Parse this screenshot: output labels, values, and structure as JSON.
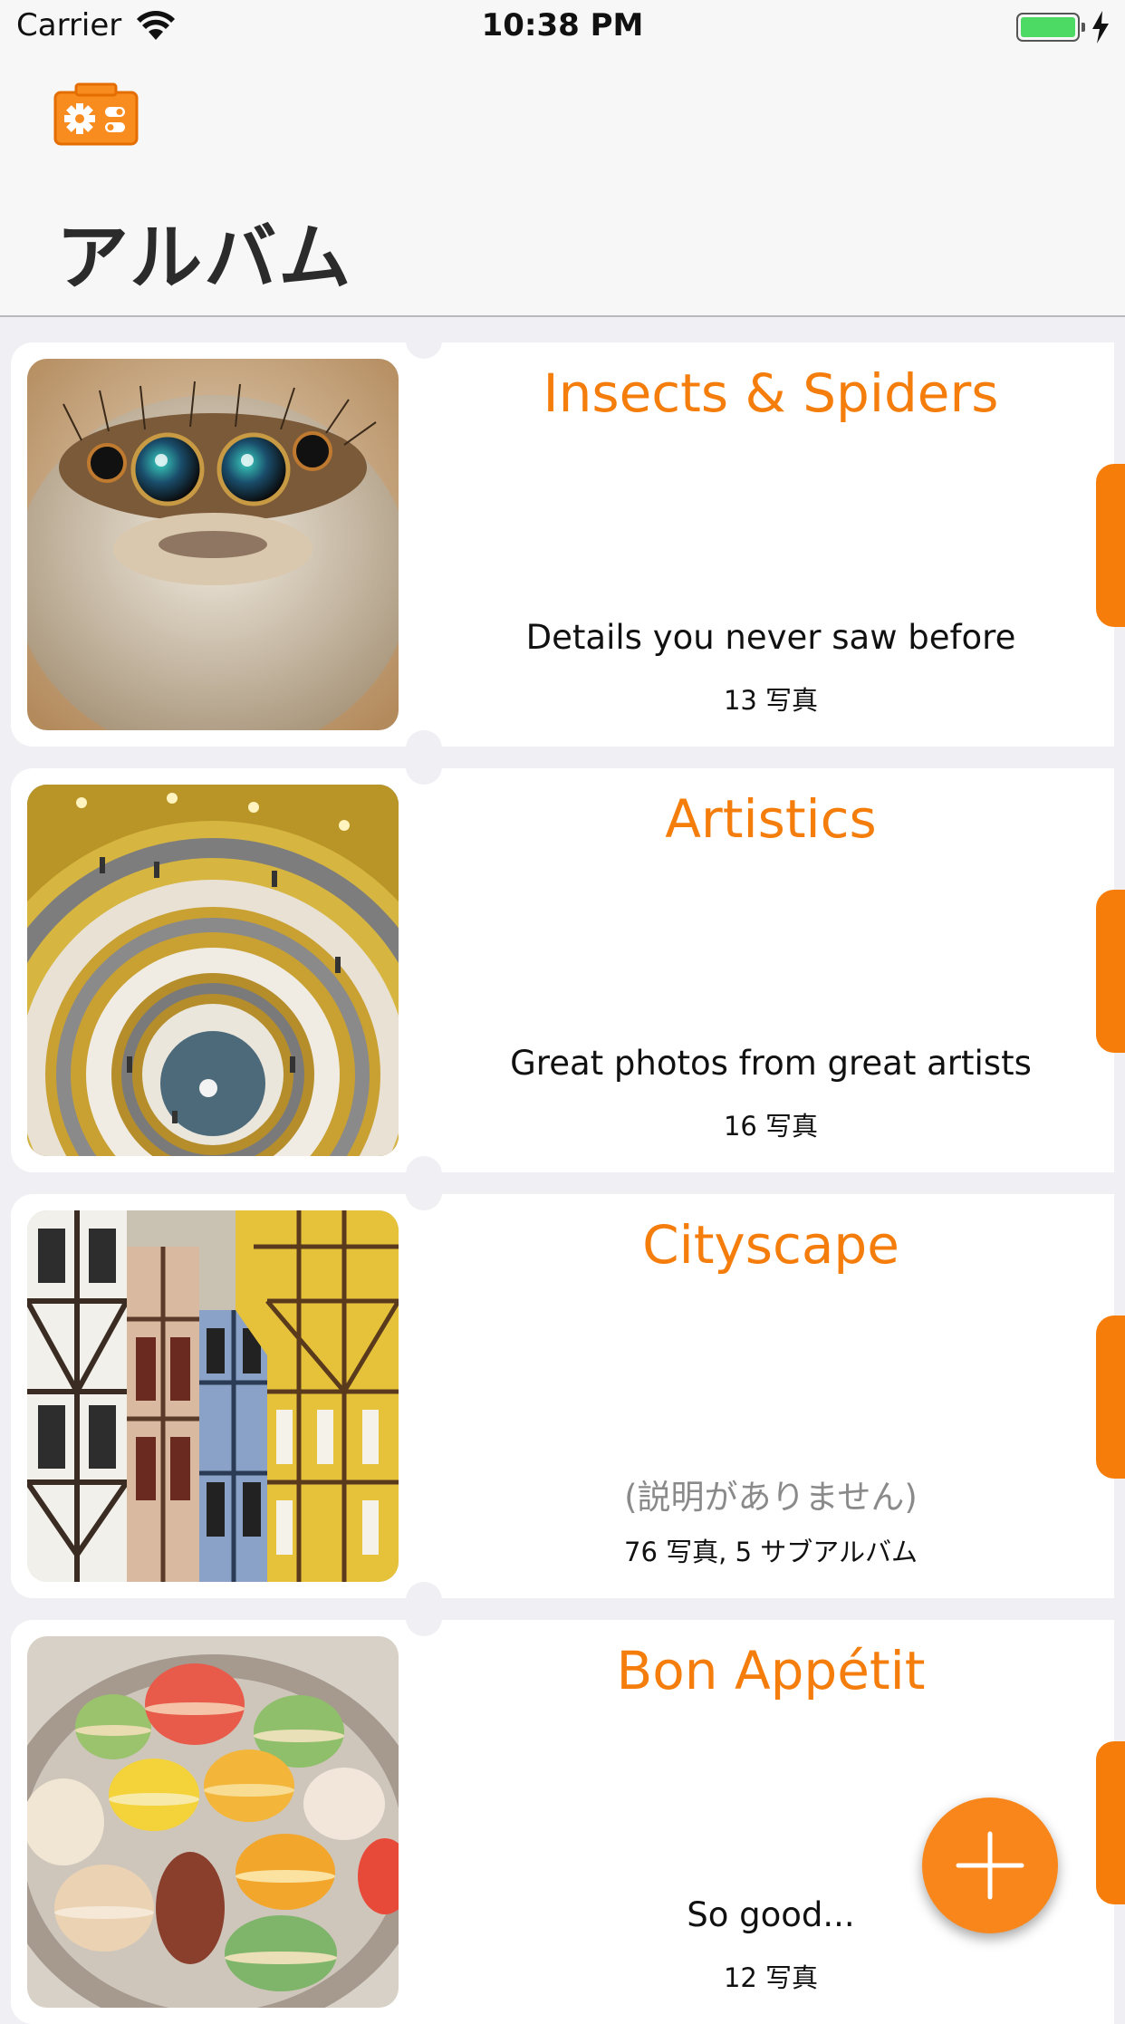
{
  "status_bar": {
    "carrier": "Carrier",
    "time": "10:38 PM"
  },
  "nav": {
    "title": "アルバム",
    "settings_icon": "camera-settings-icon"
  },
  "colors": {
    "accent": "#f47d0c",
    "background": "#efeff4"
  },
  "albums": [
    {
      "name": "Insects & Spiders",
      "description": "Details you never saw before",
      "count": "13 写真",
      "image": "jumping-spider"
    },
    {
      "name": "Artistics",
      "description": "Great photos from great artists",
      "count": "16 写真",
      "image": "spiral-staircase"
    },
    {
      "name": "Cityscape",
      "description": "(説明がありません)",
      "count": "76 写真, 5 サブアルバム",
      "image": "timber-houses"
    },
    {
      "name": "Bon Appétit",
      "description": "So good...",
      "count": "12 写真",
      "image": "macarons"
    }
  ],
  "fab": {
    "icon": "plus-icon"
  }
}
